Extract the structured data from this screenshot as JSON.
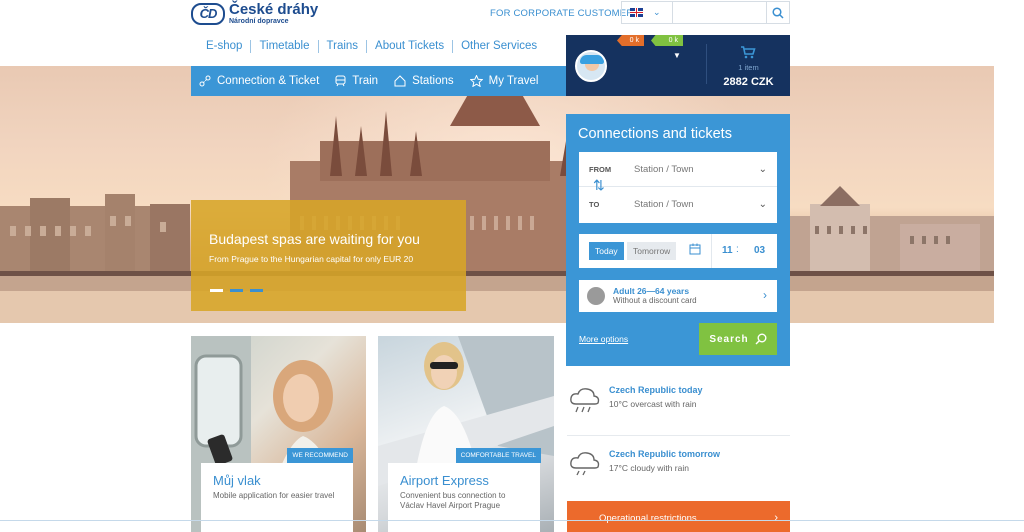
{
  "header": {
    "logo": {
      "name": "České dráhy",
      "subtitle": "Národní dopravce"
    },
    "corporate_link": "FOR CORPORATE CUSTOMERS",
    "language_icon": "uk-flag-icon",
    "search": {
      "value": "",
      "placeholder": ""
    }
  },
  "subnav": {
    "items": [
      "E-shop",
      "Timetable",
      "Trains",
      "About Tickets",
      "Other Services"
    ]
  },
  "mainnav": {
    "items": [
      {
        "label": "Connection & Ticket",
        "icon": "connection-icon"
      },
      {
        "label": "Train",
        "icon": "train-icon"
      },
      {
        "label": "Stations",
        "icon": "station-icon"
      },
      {
        "label": "My Travel",
        "icon": "star-icon"
      }
    ]
  },
  "user": {
    "points_orange": "0 k",
    "points_green": "0 k",
    "cart_items": "1 item",
    "cart_total": "2882 CZK"
  },
  "promo": {
    "title": "Budapest spas are waiting for you",
    "subtitle": "From Prague to the Hungarian capital for only EUR 20"
  },
  "booking": {
    "title": "Connections and tickets",
    "from_label": "FROM",
    "from_placeholder": "Station / Town",
    "to_label": "TO",
    "to_placeholder": "Station / Town",
    "today_label": "Today",
    "tomorrow_label": "Tomorrow",
    "hour": "11",
    "minute": "03",
    "passenger_main": "Adult 26—64 years",
    "passenger_sub": "Without a discount card",
    "more_options": "More options",
    "search_label": "Search"
  },
  "cards": [
    {
      "tag": "WE RECOMMEND",
      "title": "Můj vlak",
      "desc": "Mobile application for easier travel"
    },
    {
      "tag": "COMFORTABLE TRAVEL",
      "title": "Airport Express",
      "desc": "Convenient bus connection to Václav Havel Airport Prague"
    }
  ],
  "weather": [
    {
      "title": "Czech Republic today",
      "text": "10°C overcast with rain",
      "icon": "rain-cloud-icon"
    },
    {
      "title": "Czech Republic tomorrow",
      "text": "17°C cloudy with rain",
      "icon": "rain-cloud-icon"
    }
  ],
  "restrictions": {
    "label": "Operational restrictions"
  },
  "colors": {
    "brand_blue": "#3b96d6",
    "dark_navy": "#15325f",
    "accent_green": "#80c241",
    "accent_orange": "#ec6a2c",
    "promo_gold": "#d7a528"
  }
}
